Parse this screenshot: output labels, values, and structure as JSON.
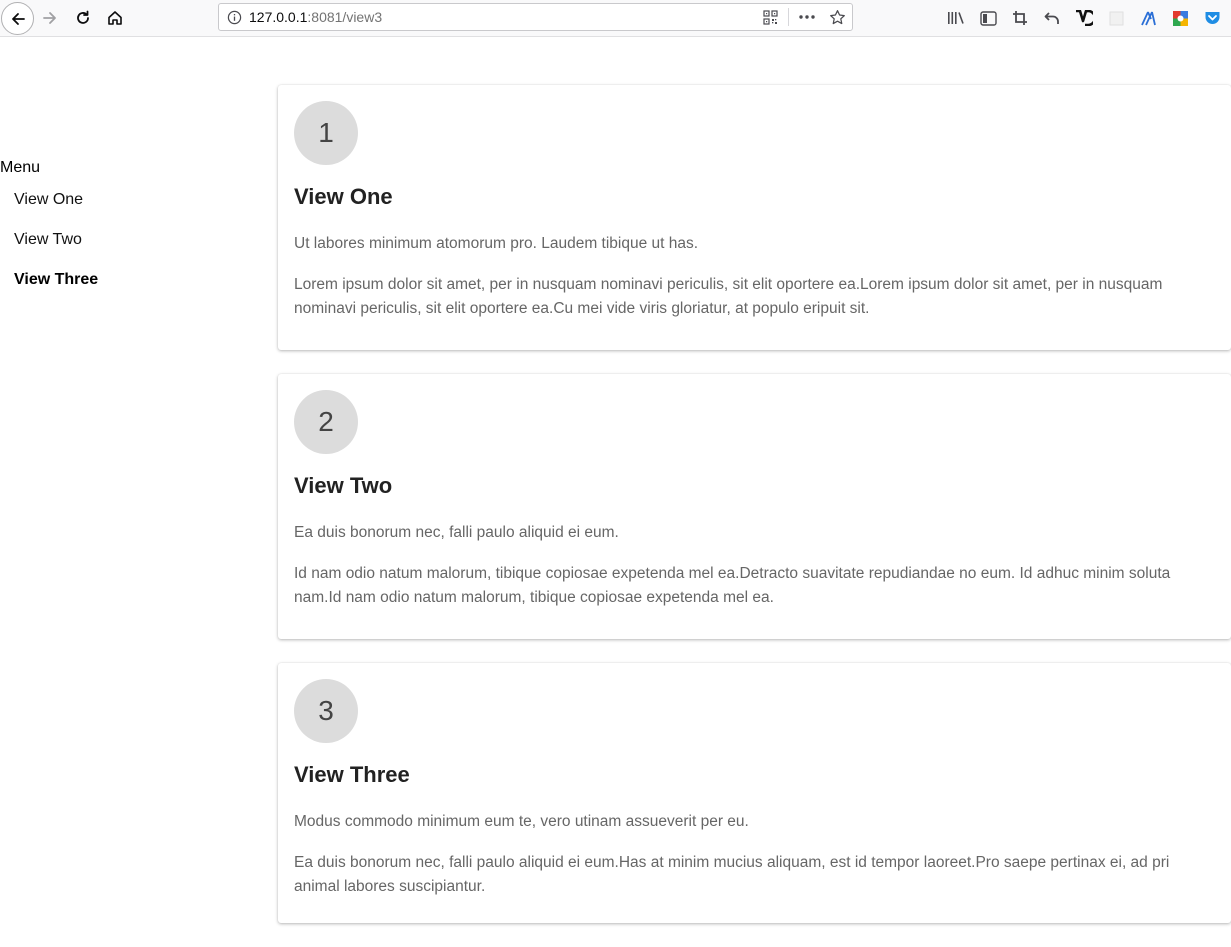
{
  "browser": {
    "url_host": "127.0.0.1",
    "url_rest": ":8081/view3"
  },
  "menu": {
    "title": "Menu",
    "items": [
      {
        "label": "View One"
      },
      {
        "label": "View Two"
      },
      {
        "label": "View Three",
        "active": true
      }
    ]
  },
  "cards": [
    {
      "number": "1",
      "title": "View One",
      "lead": "Ut labores minimum atomorum pro. Laudem tibique ut has.",
      "body": "Lorem ipsum dolor sit amet, per in nusquam nominavi periculis, sit elit oportere ea.Lorem ipsum dolor sit amet, per in nusquam nominavi periculis, sit elit oportere ea.Cu mei vide viris gloriatur, at populo eripuit sit."
    },
    {
      "number": "2",
      "title": "View Two",
      "lead": "Ea duis bonorum nec, falli paulo aliquid ei eum.",
      "body": "Id nam odio natum malorum, tibique copiosae expetenda mel ea.Detracto suavitate repudiandae no eum. Id adhuc minim soluta nam.Id nam odio natum malorum, tibique copiosae expetenda mel ea."
    },
    {
      "number": "3",
      "title": "View Three",
      "lead": "Modus commodo minimum eum te, vero utinam assueverit per eu.",
      "body": "Ea duis bonorum nec, falli paulo aliquid ei eum.Has at minim mucius aliquam, est id tempor laoreet.Pro saepe pertinax ei, ad pri animal labores suscipiantur."
    }
  ]
}
